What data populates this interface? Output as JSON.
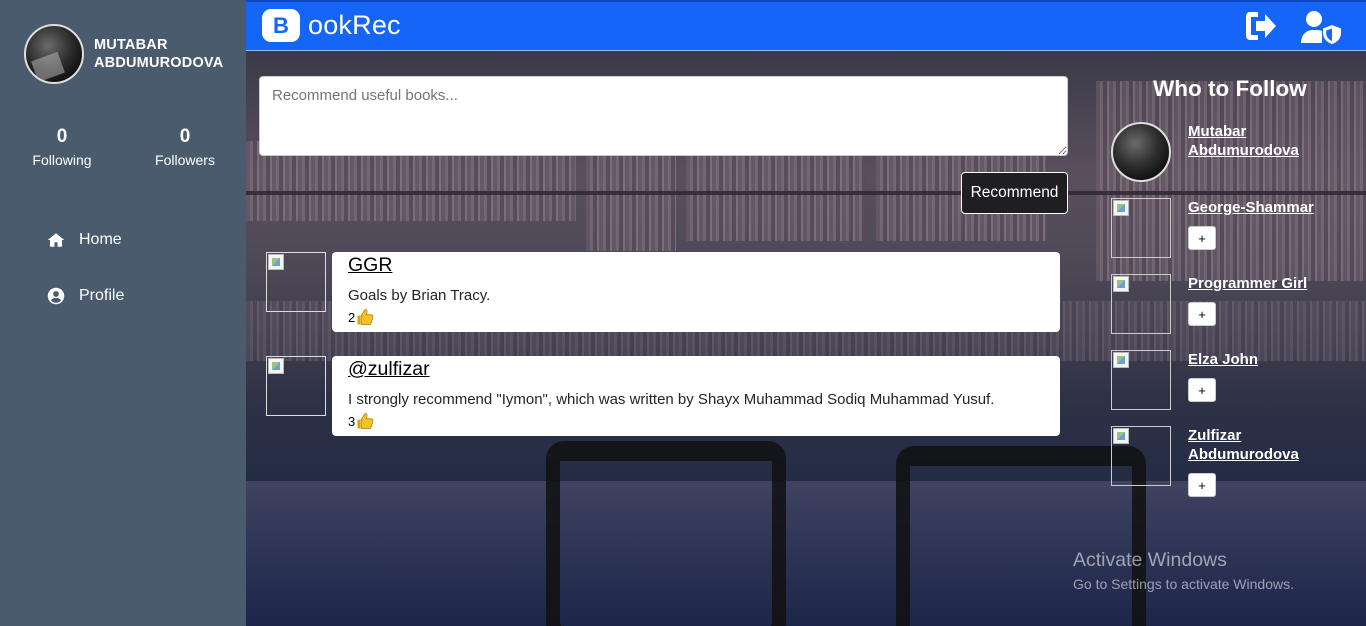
{
  "sidebar": {
    "user_name": "MUTABAR ABDUMURODOVA",
    "following_count": "0",
    "following_label": "Following",
    "followers_count": "0",
    "followers_label": "Followers",
    "nav": [
      {
        "label": "Home",
        "icon": "home-icon"
      },
      {
        "label": "Profile",
        "icon": "user-circle-icon"
      }
    ]
  },
  "topbar": {
    "logo_letter": "B",
    "brand_text": "ookRec",
    "accent_color": "#1565f8",
    "icons": [
      "logout-icon",
      "user-shield-icon"
    ]
  },
  "composer": {
    "placeholder": "Recommend useful books...",
    "submit_label": "Recommend"
  },
  "posts": [
    {
      "author": "GGR",
      "text": "Goals by Brian Tracy.",
      "likes": "2"
    },
    {
      "author": "@zulfizar",
      "text": "I strongly recommend \"Iymon\", which was written by Shayx Muhammad Sodiq Muhammad Yusuf.",
      "likes": "3"
    }
  ],
  "who_to_follow": {
    "title": "Who to Follow",
    "users": [
      {
        "name": "Mutabar Abdumurodova",
        "has_follow_button": false
      },
      {
        "name": "George-Shammar",
        "has_follow_button": true
      },
      {
        "name": "Programmer Girl",
        "has_follow_button": true
      },
      {
        "name": "Elza John",
        "has_follow_button": true
      },
      {
        "name": "Zulfizar Abdumurodova",
        "has_follow_button": true
      }
    ],
    "follow_label": "+"
  },
  "watermark": {
    "line1": "Activate Windows",
    "line2": "Go to Settings to activate Windows."
  }
}
